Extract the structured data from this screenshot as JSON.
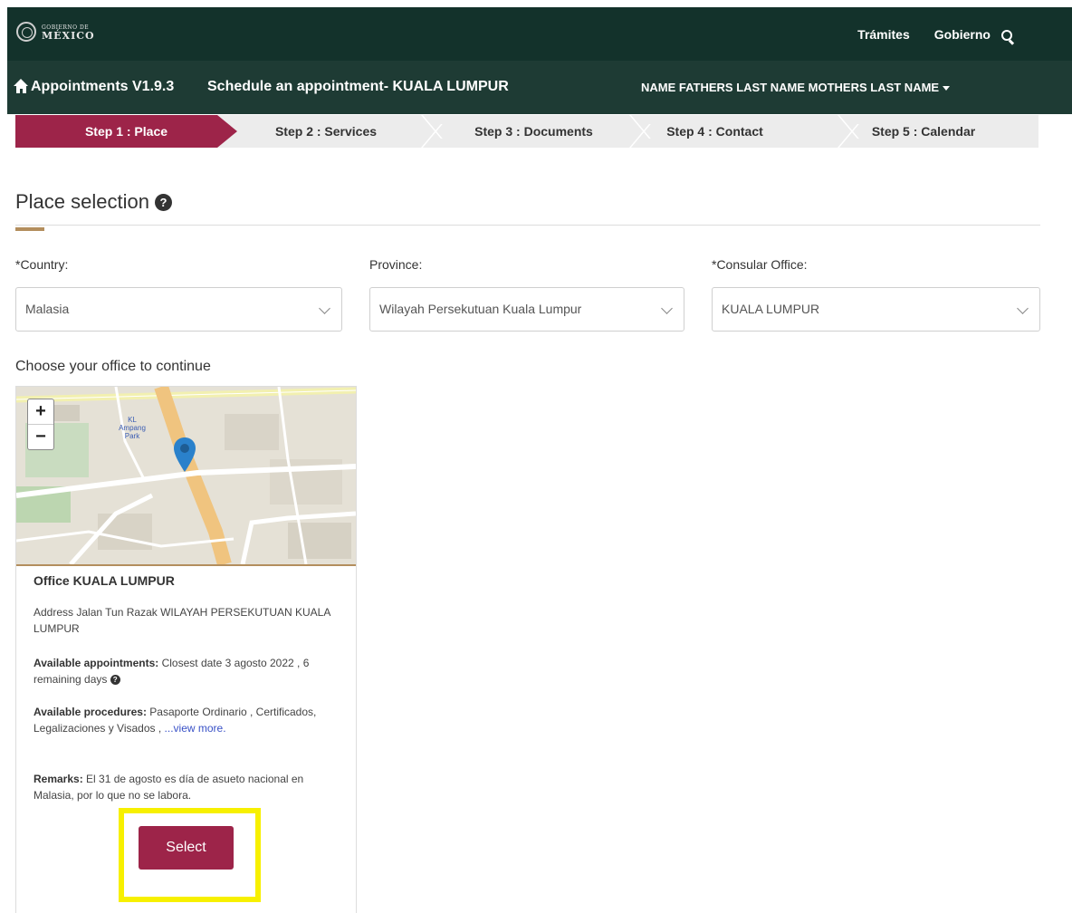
{
  "header": {
    "logo_small": "GOBIERNO DE",
    "logo_big": "MÉXICO",
    "nav": [
      "Trámites",
      "Gobierno"
    ],
    "search_icon": "search-icon"
  },
  "subheader": {
    "app_title": "Appointments V1.9.3",
    "page_subtitle": "Schedule an appointment- KUALA LUMPUR",
    "user_name": "NAME FATHERS LAST NAME MOTHERS LAST NAME",
    "home_icon": "home-icon"
  },
  "steps": [
    {
      "label": "Step 1 : Place",
      "active": true
    },
    {
      "label": "Step 2 : Services",
      "active": false
    },
    {
      "label": "Step 3 : Documents",
      "active": false
    },
    {
      "label": "Step 4 : Contact",
      "active": false
    },
    {
      "label": "Step 5 : Calendar",
      "active": false
    }
  ],
  "section": {
    "title": "Place selection"
  },
  "form": {
    "country_label": "*Country:",
    "country_value": "Malasia",
    "province_label": "Province:",
    "province_value": "Wilayah Persekutuan Kuala Lumpur",
    "office_label": "*Consular Office:",
    "office_value": "KUALA LUMPUR"
  },
  "choose_label": "Choose your office to continue",
  "office_card": {
    "zoom_in": "+",
    "zoom_out": "−",
    "map_label": "KL Ampang Park",
    "title": "Office KUALA LUMPUR",
    "address": "Address Jalan Tun Razak WILAYAH PERSEKUTUAN KUALA LUMPUR",
    "appointments_label": "Available appointments:",
    "appointments_text": "Closest date 3 agosto 2022 , 6 remaining days",
    "procedures_label": "Available procedures:",
    "procedures_text": "Pasaporte Ordinario , Certificados, Legalizaciones y Visados ,",
    "view_more": "...view more.",
    "remarks_label": "Remarks:",
    "remarks_text": "El 31 de agosto es día de asueto nacional en Malasia, por lo que no se labora.",
    "select_label": "Select"
  },
  "colors": {
    "header_bg": "#13322b",
    "subheader_bg": "#1e3b34",
    "accent": "#9d2449",
    "gold": "#b38e5d",
    "highlight": "#f7f000"
  }
}
